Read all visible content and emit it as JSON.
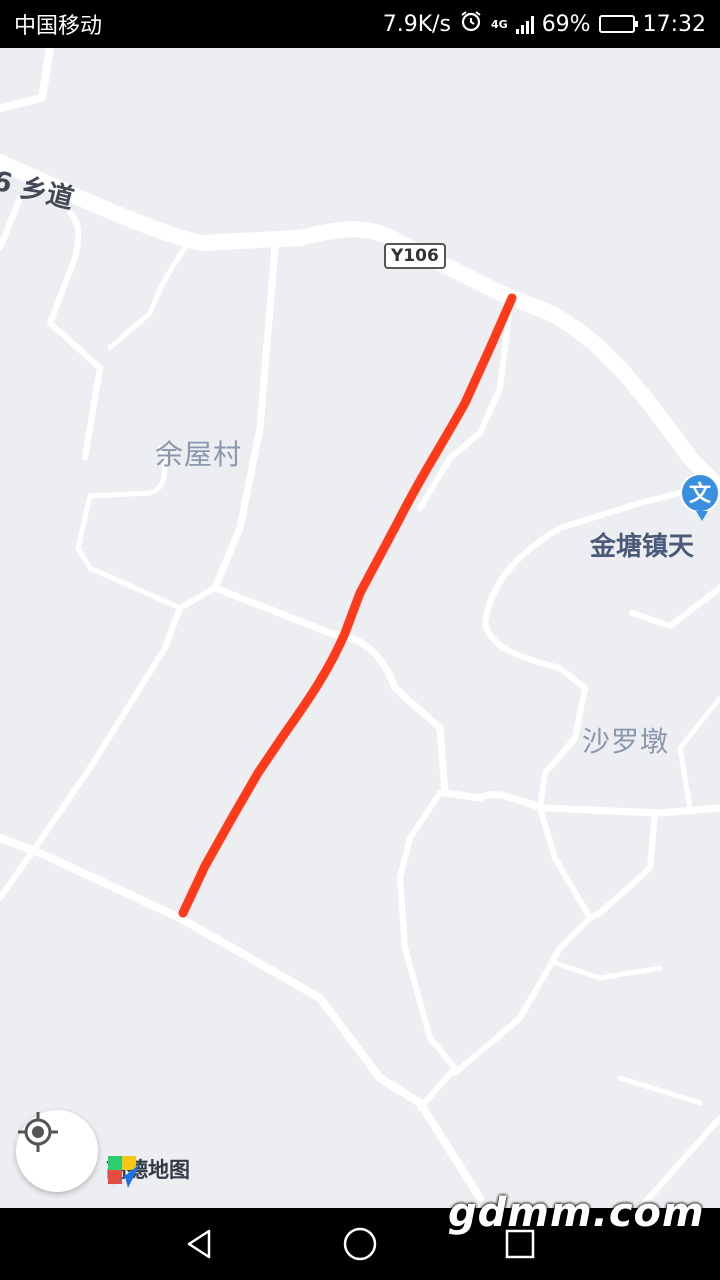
{
  "status_bar": {
    "carrier": "中国移动",
    "speed": "7.9K/s",
    "network": "4G",
    "battery": "69%",
    "battery_level": 0.69,
    "time": "17:32"
  },
  "map": {
    "road_label": "6 乡道",
    "road_badge": "Y106",
    "villages": [
      "余屋村",
      "沙罗墩"
    ],
    "poi": {
      "label": "金塘镇天",
      "icon": "school-icon",
      "glyph": "文"
    },
    "route_color": "#ff3a1a",
    "background_color": "#eceef1"
  },
  "brand": {
    "text": "高德地图"
  },
  "watermark": "gdmm.com",
  "nav": {
    "back": "back-icon",
    "home": "home-icon",
    "recents": "recents-icon"
  }
}
